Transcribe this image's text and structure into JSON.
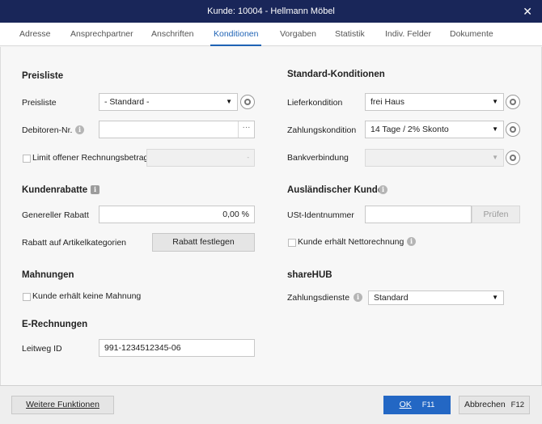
{
  "window": {
    "title": "Kunde: 10004 - Hellmann Möbel",
    "close": "✕"
  },
  "tabs": [
    "Adresse",
    "Ansprechpartner",
    "Anschriften",
    "Konditionen",
    "Vorgaben",
    "Statistik",
    "Indiv. Felder",
    "Dokumente"
  ],
  "preisliste": {
    "heading": "Preisliste",
    "preisliste_label": "Preisliste",
    "preisliste_value": "- Standard -",
    "debitoren_label": "Debitoren-Nr.",
    "debitoren_value": "",
    "ellipsis": "···",
    "limit_label": "Limit offener Rechnungsbetrag",
    "limit_value": "-"
  },
  "kundenrabatte": {
    "heading": "Kundenrabatte",
    "genereller_label": "Genereller Rabatt",
    "genereller_value": "0,00 %",
    "artikel_label": "Rabatt auf Artikelkategorien",
    "button": "Rabatt festlegen"
  },
  "mahnungen": {
    "heading": "Mahnungen",
    "checkbox_label": "Kunde erhält keine Mahnung"
  },
  "erechnungen": {
    "heading": "E-Rechnungen",
    "leitweg_label": "Leitweg ID",
    "leitweg_value": "991-1234512345-06"
  },
  "standard": {
    "heading": "Standard-Konditionen",
    "liefer_label": "Lieferkondition",
    "liefer_value": "frei Haus",
    "zahlung_label": "Zahlungskondition",
    "zahlung_value": "14 Tage / 2% Skonto",
    "bank_label": "Bankverbindung",
    "bank_value": ""
  },
  "auslaendisch": {
    "heading": "Ausländischer Kunde",
    "ust_label": "USt-Identnummer",
    "ust_value": "",
    "pruefen_button": "Prüfen",
    "netto_label": "Kunde erhält Nettorechnung"
  },
  "sharehub": {
    "heading": "shareHUB",
    "zahlungsdienste_label": "Zahlungsdienste",
    "zahlungsdienste_value": "Standard"
  },
  "footer": {
    "weitere_button": "Weitere Funktionen",
    "ok_button": "OK",
    "ok_shortcut": "F11",
    "abbrechen_button": "Abbrechen",
    "abbrechen_shortcut": "F12"
  },
  "icons": {
    "info": "i",
    "caret": "▼"
  }
}
